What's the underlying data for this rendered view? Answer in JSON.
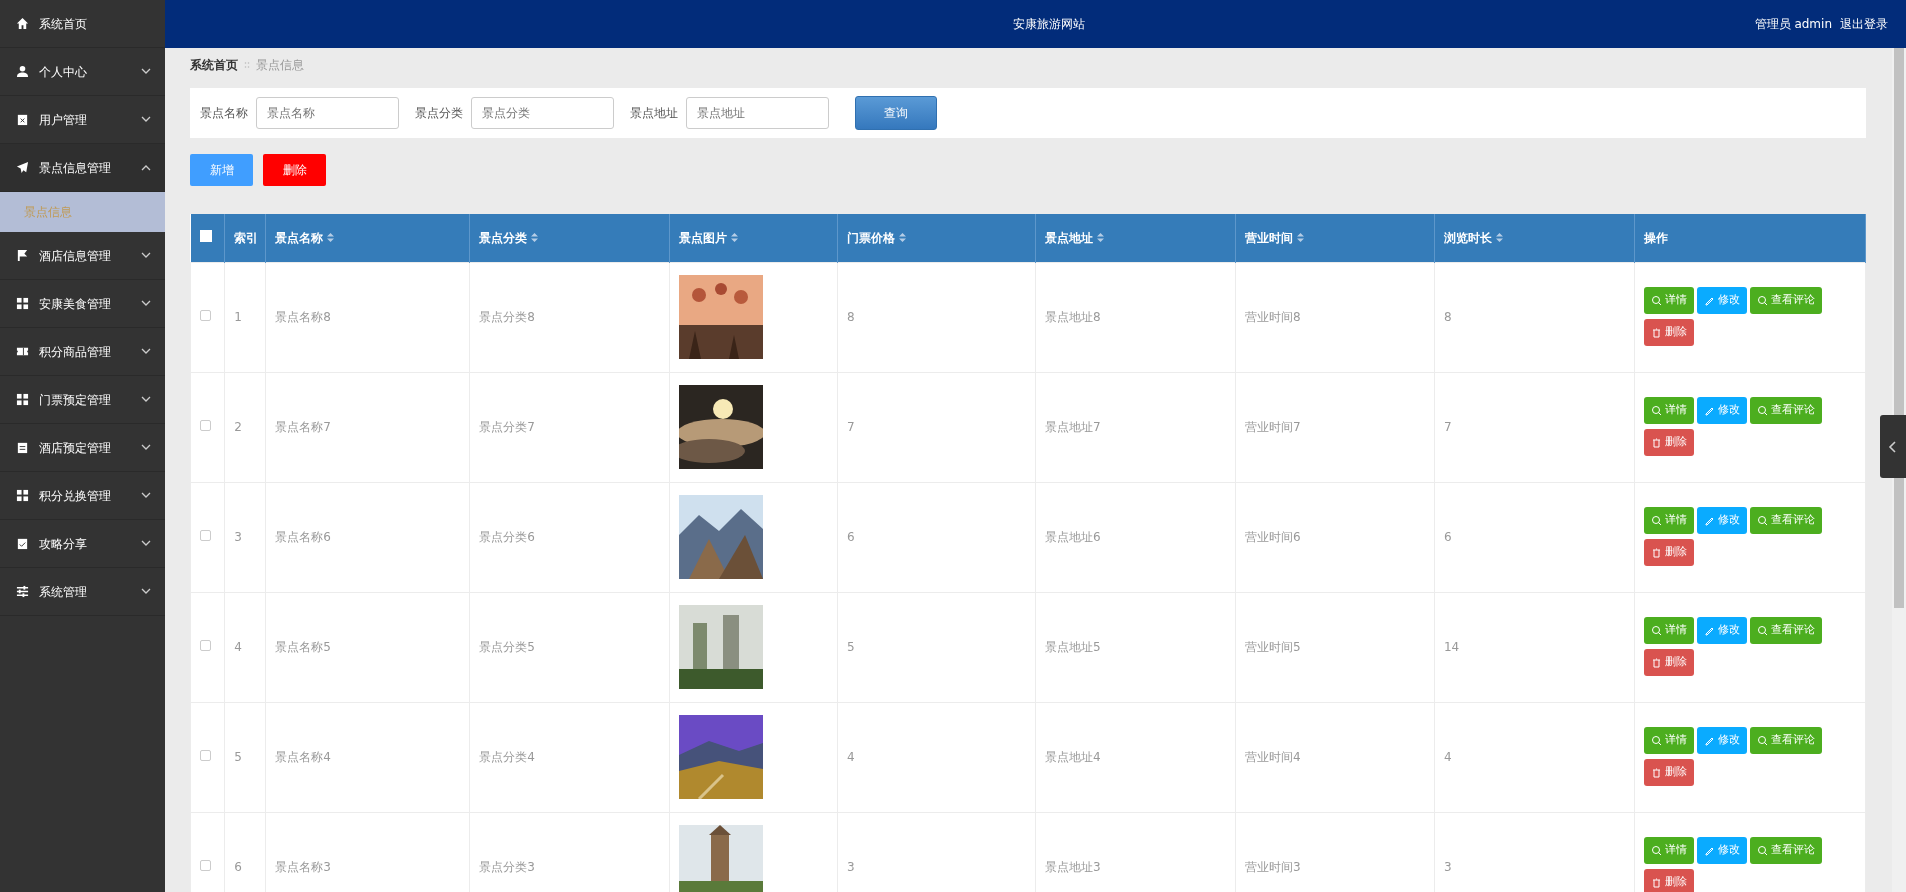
{
  "sidebar": {
    "items": [
      {
        "label": "系统首页",
        "kind": "link"
      },
      {
        "label": "个人中心",
        "kind": "menu",
        "expanded": false
      },
      {
        "label": "用户管理",
        "kind": "menu",
        "expanded": false
      },
      {
        "label": "景点信息管理",
        "kind": "menu",
        "expanded": true,
        "children": [
          {
            "label": "景点信息",
            "selected": true
          }
        ]
      },
      {
        "label": "酒店信息管理",
        "kind": "menu",
        "expanded": false
      },
      {
        "label": "安康美食管理",
        "kind": "menu",
        "expanded": false
      },
      {
        "label": "积分商品管理",
        "kind": "menu",
        "expanded": false
      },
      {
        "label": "门票预定管理",
        "kind": "menu",
        "expanded": false
      },
      {
        "label": "酒店预定管理",
        "kind": "menu",
        "expanded": false
      },
      {
        "label": "积分兑换管理",
        "kind": "menu",
        "expanded": false
      },
      {
        "label": "攻略分享",
        "kind": "menu",
        "expanded": false
      },
      {
        "label": "系统管理",
        "kind": "menu",
        "expanded": false
      }
    ]
  },
  "header": {
    "title": "安康旅游网站",
    "user": "管理员 admin",
    "logout": "退出登录"
  },
  "breadcrumb": [
    "系统首页",
    "景点信息"
  ],
  "search": {
    "fields": [
      {
        "label": "景点名称",
        "placeholder": "景点名称"
      },
      {
        "label": "景点分类",
        "placeholder": "景点分类"
      },
      {
        "label": "景点地址",
        "placeholder": "景点地址"
      }
    ],
    "button": "查询"
  },
  "toolbar": [
    {
      "label": "新增",
      "kind": "add"
    },
    {
      "label": "删除",
      "kind": "delete"
    }
  ],
  "table": {
    "select_all": {
      "checked": false
    },
    "columns": [
      {
        "label": "索引",
        "sortable": false
      },
      {
        "label": "景点名称",
        "sortable": true
      },
      {
        "label": "景点分类",
        "sortable": true
      },
      {
        "label": "景点图片",
        "sortable": true
      },
      {
        "label": "门票价格",
        "sortable": true
      },
      {
        "label": "景点地址",
        "sortable": true
      },
      {
        "label": "营业时间",
        "sortable": true
      },
      {
        "label": "浏览时长",
        "sortable": true
      },
      {
        "label": "操作",
        "sortable": false
      }
    ],
    "rows": [
      {
        "checked": false,
        "index": "1",
        "name": "景点名称8",
        "category": "景点分类8",
        "price": "8",
        "address": "景点地址8",
        "hours": "营业时间8",
        "duration": "8",
        "actions": [
          {
            "label": "详情",
            "kind": "detail"
          },
          {
            "label": "修改",
            "kind": "edit"
          },
          {
            "label": "查看评论",
            "kind": "comments"
          },
          {
            "label": "删除",
            "kind": "delete"
          }
        ]
      },
      {
        "checked": false,
        "index": "2",
        "name": "景点名称7",
        "category": "景点分类7",
        "price": "7",
        "address": "景点地址7",
        "hours": "营业时间7",
        "duration": "7",
        "actions": [
          {
            "label": "详情",
            "kind": "detail"
          },
          {
            "label": "修改",
            "kind": "edit"
          },
          {
            "label": "查看评论",
            "kind": "comments"
          },
          {
            "label": "删除",
            "kind": "delete"
          }
        ]
      },
      {
        "checked": false,
        "index": "3",
        "name": "景点名称6",
        "category": "景点分类6",
        "price": "6",
        "address": "景点地址6",
        "hours": "营业时间6",
        "duration": "6",
        "actions": [
          {
            "label": "详情",
            "kind": "detail"
          },
          {
            "label": "修改",
            "kind": "edit"
          },
          {
            "label": "查看评论",
            "kind": "comments"
          },
          {
            "label": "删除",
            "kind": "delete"
          }
        ]
      },
      {
        "checked": false,
        "index": "4",
        "name": "景点名称5",
        "category": "景点分类5",
        "price": "5",
        "address": "景点地址5",
        "hours": "营业时间5",
        "duration": "14",
        "actions": [
          {
            "label": "详情",
            "kind": "detail"
          },
          {
            "label": "修改",
            "kind": "edit"
          },
          {
            "label": "查看评论",
            "kind": "comments"
          },
          {
            "label": "删除",
            "kind": "delete"
          }
        ]
      },
      {
        "checked": false,
        "index": "5",
        "name": "景点名称4",
        "category": "景点分类4",
        "price": "4",
        "address": "景点地址4",
        "hours": "营业时间4",
        "duration": "4",
        "actions": [
          {
            "label": "详情",
            "kind": "detail"
          },
          {
            "label": "修改",
            "kind": "edit"
          },
          {
            "label": "查看评论",
            "kind": "comments"
          },
          {
            "label": "删除",
            "kind": "delete"
          }
        ]
      },
      {
        "checked": false,
        "index": "6",
        "name": "景点名称3",
        "category": "景点分类3",
        "price": "3",
        "address": "景点地址3",
        "hours": "营业时间3",
        "duration": "3",
        "actions": [
          {
            "label": "详情",
            "kind": "detail"
          },
          {
            "label": "修改",
            "kind": "edit"
          },
          {
            "label": "查看评论",
            "kind": "comments"
          },
          {
            "label": "删除",
            "kind": "delete"
          }
        ]
      }
    ]
  }
}
